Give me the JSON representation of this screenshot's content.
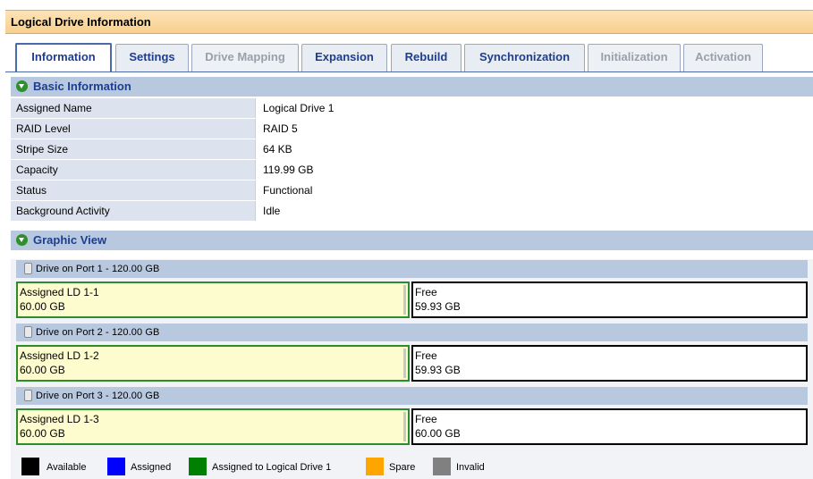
{
  "window": {
    "title": "Logical Drive Information"
  },
  "tabs": [
    {
      "label": "Information",
      "state": "active"
    },
    {
      "label": "Settings",
      "state": "enabled"
    },
    {
      "label": "Drive Mapping",
      "state": "disabled"
    },
    {
      "label": "Expansion",
      "state": "enabled"
    },
    {
      "label": "Rebuild",
      "state": "enabled"
    },
    {
      "label": "Synchronization",
      "state": "enabled"
    },
    {
      "label": "Initialization",
      "state": "disabled"
    },
    {
      "label": "Activation",
      "state": "disabled"
    }
  ],
  "basic_info": {
    "title": "Basic Information",
    "rows": [
      {
        "label": "Assigned Name",
        "value": "Logical Drive 1"
      },
      {
        "label": "RAID Level",
        "value": "RAID 5"
      },
      {
        "label": "Stripe Size",
        "value": "64 KB"
      },
      {
        "label": "Capacity",
        "value": "119.99 GB"
      },
      {
        "label": "Status",
        "value": "Functional"
      },
      {
        "label": "Background Activity",
        "value": "Idle"
      }
    ]
  },
  "graphic_view": {
    "title": "Graphic View",
    "drives": [
      {
        "header": "Drive on Port 1 - 120.00 GB",
        "assigned": {
          "name": "Assigned LD 1-1",
          "size": "60.00 GB"
        },
        "free": {
          "name": "Free",
          "size": "59.93 GB"
        }
      },
      {
        "header": "Drive on Port 2 - 120.00 GB",
        "assigned": {
          "name": "Assigned LD 1-2",
          "size": "60.00 GB"
        },
        "free": {
          "name": "Free",
          "size": "59.93 GB"
        }
      },
      {
        "header": "Drive on Port 3 - 120.00 GB",
        "assigned": {
          "name": "Assigned LD 1-3",
          "size": "60.00 GB"
        },
        "free": {
          "name": "Free",
          "size": "60.00 GB"
        }
      }
    ]
  },
  "legend": [
    {
      "label": "Available",
      "color": "#000000"
    },
    {
      "label": "Assigned",
      "color": "#0000ff"
    },
    {
      "label": "Assigned to Logical Drive 1",
      "color": "#008000"
    },
    {
      "label": "Spare",
      "color": "#ffa500"
    },
    {
      "label": "Invalid",
      "color": "#808080"
    }
  ],
  "colors": {
    "section_bg": "#b8c8df",
    "title_bg": "#f8cf8f",
    "tab_text": "#1d3e8f"
  }
}
